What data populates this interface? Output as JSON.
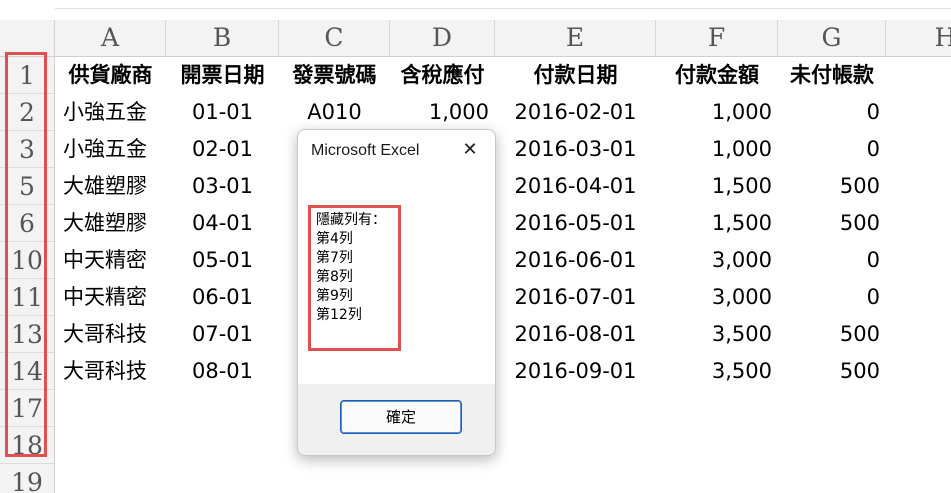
{
  "columns": [
    "A",
    "B",
    "C",
    "D",
    "E",
    "F",
    "G",
    "H"
  ],
  "rows": [
    "1",
    "2",
    "3",
    "5",
    "6",
    "10",
    "11",
    "13",
    "14",
    "17",
    "18",
    "19"
  ],
  "table": {
    "headers": [
      "供貨廠商",
      "開票日期",
      "發票號碼",
      "含稅應付",
      "付款日期",
      "付款金額",
      "未付帳款"
    ],
    "records": [
      [
        "小強五金",
        "01-01",
        "A010",
        "1,000",
        "2016-02-01",
        "1,000",
        "0"
      ],
      [
        "小強五金",
        "02-01",
        "",
        "",
        "2016-03-01",
        "1,000",
        "0"
      ],
      [
        "大雄塑膠",
        "03-01",
        "",
        "",
        "2016-04-01",
        "1,500",
        "500"
      ],
      [
        "大雄塑膠",
        "04-01",
        "",
        "",
        "2016-05-01",
        "1,500",
        "500"
      ],
      [
        "中天精密",
        "05-01",
        "",
        "",
        "2016-06-01",
        "3,000",
        "0"
      ],
      [
        "中天精密",
        "06-01",
        "",
        "",
        "2016-07-01",
        "3,000",
        "0"
      ],
      [
        "大哥科技",
        "07-01",
        "",
        "",
        "2016-08-01",
        "3,500",
        "500"
      ],
      [
        "大哥科技",
        "08-01",
        "",
        "",
        "2016-09-01",
        "3,500",
        "500"
      ]
    ]
  },
  "dialog": {
    "title": "Microsoft Excel",
    "close_glyph": "✕",
    "message_lines": [
      "隱藏列有：",
      "第4列",
      "第7列",
      "第8列",
      "第9列",
      "第12列"
    ],
    "ok_label": "確定"
  },
  "colors": {
    "highlight": "#e0504f",
    "header_bg": "#f3f3f3",
    "button_border": "#1e5fb4"
  }
}
